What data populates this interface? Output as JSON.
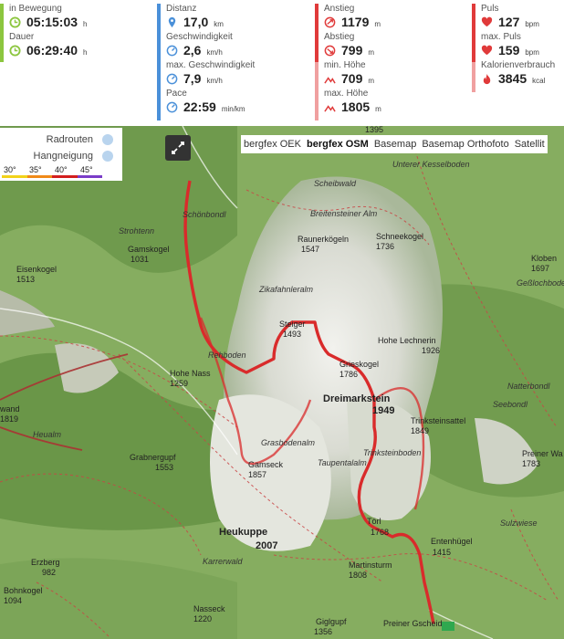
{
  "stats": {
    "col1": [
      {
        "label": "in Bewegung",
        "value": "05:15:03",
        "unit": "h",
        "icon": "clock-icon"
      },
      {
        "label": "Dauer",
        "value": "06:29:40",
        "unit": "h",
        "icon": "clock-icon"
      }
    ],
    "col2": [
      {
        "label": "Distanz",
        "value": "17,0",
        "unit": "km",
        "icon": "route-pin-icon"
      },
      {
        "label": "Geschwindigkeit",
        "value": "2,6",
        "unit": "km/h",
        "icon": "speedometer-icon"
      },
      {
        "label": "max. Geschwindigkeit",
        "value": "7,9",
        "unit": "km/h",
        "icon": "speedometer-icon"
      },
      {
        "label": "Pace",
        "value": "22:59",
        "unit": "min/km",
        "icon": "speedometer-icon"
      }
    ],
    "col3": [
      {
        "label": "Anstieg",
        "value": "1179",
        "unit": "m",
        "icon": "ascent-icon"
      },
      {
        "label": "Abstieg",
        "value": "799",
        "unit": "m",
        "icon": "descent-icon"
      },
      {
        "label": "min. Höhe",
        "value": "709",
        "unit": "m",
        "icon": "mountain-icon"
      },
      {
        "label": "max. Höhe",
        "value": "1805",
        "unit": "m",
        "icon": "mountain-icon"
      }
    ],
    "col4": [
      {
        "label": "Puls",
        "value": "127",
        "unit": "bpm",
        "icon": "heart-icon"
      },
      {
        "label": "max. Puls",
        "value": "159",
        "unit": "bpm",
        "icon": "heart-icon"
      },
      {
        "label": "Kalorienverbrauch",
        "value": "3845",
        "unit": "kcal",
        "icon": "flame-icon"
      }
    ]
  },
  "colors": {
    "green": "#8cc63f",
    "blue": "#4a90d9",
    "red": "#e03a3a",
    "route": "#d92b2b"
  },
  "layers": [
    "bergfex OEK",
    "bergfex OSM",
    "Basemap",
    "Basemap Orthofoto",
    "Satellit"
  ],
  "active_layer": "bergfex OSM",
  "legend": {
    "radrouten": "Radrouten",
    "hangneigung": "Hangneigung",
    "degrees": [
      "30°",
      "35°",
      "40°",
      "45°"
    ]
  },
  "map_labels": {
    "schoenboendl": "Schönbondl",
    "strohtenn": "Strohtenn",
    "gamskogel": "Gamskogel",
    "gamskogel_h": "1031",
    "eisenkogel": "Eisenkogel",
    "eisenkogel_h": "1513",
    "zikafahnleralm": "Zikafahnleralm",
    "raunerkoegeln": "Raunerkögeln",
    "raunerkoegeln_h": "1547",
    "schneekogel": "Schneekogel",
    "schneekogel_h": "1736",
    "breitensteiner": "Breitensteiner Alm",
    "scheibwald": "Scheibwald",
    "unterer": "Unterer Kesselboden",
    "kloben": "Kloben",
    "kloben_h": "1697",
    "gessloch": "Geßlochboden",
    "steiger": "Steiger",
    "steiger_h": "1493",
    "rehboden": "Rehboden",
    "hohenass": "Hohe Nass",
    "hohenass_h": "1259",
    "grieskogel": "Grieskogel",
    "grieskogel_h": "1786",
    "hohelechnerin": "Hohe Lechnerin",
    "hohelechnerin_h": "1926",
    "dreimarkstein": "Dreimarkstein",
    "dreimarkstein_h": "1949",
    "trinksteinsattel": "Trinksteinsattel",
    "trinksteinsattel_h": "1849",
    "trinksteinboden": "Trinksteinboden",
    "seebondl": "Seebondl",
    "natterbondl": "Natterbondl",
    "wand": "wand",
    "wand_h": "1819",
    "heualm": "Heualm",
    "grabnergupf": "Grabnergupf",
    "grabnergupf_h": "1553",
    "grasbodenalm": "Grasbodenalm",
    "gamseck": "Gamseck",
    "gamseck_h": "1857",
    "taupentalalm": "Taupentalalm",
    "preinerwand": "Preiner Wa",
    "preinerwand_h": "1783",
    "heukuppe": "Heukuppe",
    "heukuppe_h": "2007",
    "toerl": "Törl",
    "toerl_h": "1768",
    "entenhuegel": "Entenhügel",
    "entenhuegel_h": "1415",
    "martinsturm": "Martinsturm",
    "martinsturm_h": "1808",
    "sulzwiese": "Sulzwiese",
    "karrerwald": "Karrerwald",
    "erzberg": "Erzberg",
    "erzberg_h": "982",
    "bohnkogel": "Bohnkogel",
    "bohnkogel_h": "1094",
    "nasseck": "Nasseck",
    "nasseck_h": "1220",
    "giglgupf": "Giglgupf",
    "giglgupf_h": "1356",
    "preinergscheid": "Preiner Gscheid",
    "top1395": "1395"
  }
}
